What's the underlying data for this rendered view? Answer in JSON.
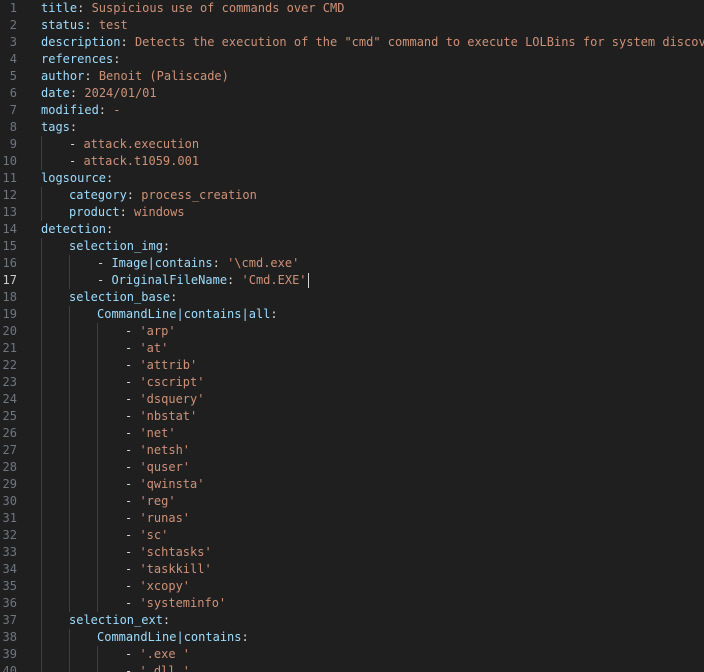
{
  "editor": {
    "current_line": 17,
    "lines": [
      {
        "n": "1",
        "indent": 0,
        "key": "title",
        "sep": ":",
        "val": " Suspicious use of commands over CMD",
        "valClass": "str"
      },
      {
        "n": "2",
        "indent": 0,
        "key": "status",
        "sep": ":",
        "val": " test",
        "valClass": "str"
      },
      {
        "n": "3",
        "indent": 0,
        "key": "description",
        "sep": ":",
        "val": " Detects the execution of the \"cmd\" command to execute LOLBins for system discovery",
        "valClass": "str"
      },
      {
        "n": "4",
        "indent": 0,
        "key": "references",
        "sep": ":",
        "val": "",
        "valClass": "str"
      },
      {
        "n": "5",
        "indent": 0,
        "key": "author",
        "sep": ":",
        "val": " Benoit (Paliscade)",
        "valClass": "str"
      },
      {
        "n": "6",
        "indent": 0,
        "key": "date",
        "sep": ":",
        "val": " 2024/01/01",
        "valClass": "str"
      },
      {
        "n": "7",
        "indent": 0,
        "key": "modified",
        "sep": ":",
        "val": " -",
        "valClass": "str"
      },
      {
        "n": "8",
        "indent": 0,
        "key": "tags",
        "sep": ":",
        "val": "",
        "valClass": "str"
      },
      {
        "n": "9",
        "indent": 1,
        "dash": "- ",
        "key": "",
        "sep": "",
        "val": "attack.execution",
        "valClass": "str"
      },
      {
        "n": "10",
        "indent": 1,
        "dash": "- ",
        "key": "",
        "sep": "",
        "val": "attack.t1059.001",
        "valClass": "str"
      },
      {
        "n": "11",
        "indent": 0,
        "key": "logsource",
        "sep": ":",
        "val": "",
        "valClass": "str"
      },
      {
        "n": "12",
        "indent": 1,
        "key": "category",
        "sep": ":",
        "val": " process_creation",
        "valClass": "str"
      },
      {
        "n": "13",
        "indent": 1,
        "key": "product",
        "sep": ":",
        "val": " windows",
        "valClass": "str"
      },
      {
        "n": "14",
        "indent": 0,
        "key": "detection",
        "sep": ":",
        "val": "",
        "valClass": "str"
      },
      {
        "n": "15",
        "indent": 1,
        "key": "selection_img",
        "sep": ":",
        "val": "",
        "valClass": "str"
      },
      {
        "n": "16",
        "indent": 2,
        "dash": "- ",
        "key": "Image|contains",
        "sep": ":",
        "val": " '\\cmd.exe'",
        "valClass": "str"
      },
      {
        "n": "17",
        "indent": 2,
        "dash": "- ",
        "key": "OriginalFileName",
        "sep": ":",
        "val": " 'Cmd.EXE'",
        "valClass": "str",
        "cursor": true
      },
      {
        "n": "18",
        "indent": 1,
        "key": "selection_base",
        "sep": ":",
        "val": "",
        "valClass": "str"
      },
      {
        "n": "19",
        "indent": 2,
        "key": "CommandLine|contains|all",
        "sep": ":",
        "val": "",
        "valClass": "str"
      },
      {
        "n": "20",
        "indent": 3,
        "dash": "- ",
        "key": "",
        "sep": "",
        "val": "'arp'",
        "valClass": "str"
      },
      {
        "n": "21",
        "indent": 3,
        "dash": "- ",
        "key": "",
        "sep": "",
        "val": "'at'",
        "valClass": "str"
      },
      {
        "n": "22",
        "indent": 3,
        "dash": "- ",
        "key": "",
        "sep": "",
        "val": "'attrib'",
        "valClass": "str"
      },
      {
        "n": "23",
        "indent": 3,
        "dash": "- ",
        "key": "",
        "sep": "",
        "val": "'cscript'",
        "valClass": "str"
      },
      {
        "n": "24",
        "indent": 3,
        "dash": "- ",
        "key": "",
        "sep": "",
        "val": "'dsquery'",
        "valClass": "str"
      },
      {
        "n": "25",
        "indent": 3,
        "dash": "- ",
        "key": "",
        "sep": "",
        "val": "'nbstat'",
        "valClass": "str"
      },
      {
        "n": "26",
        "indent": 3,
        "dash": "- ",
        "key": "",
        "sep": "",
        "val": "'net'",
        "valClass": "str"
      },
      {
        "n": "27",
        "indent": 3,
        "dash": "- ",
        "key": "",
        "sep": "",
        "val": "'netsh'",
        "valClass": "str"
      },
      {
        "n": "28",
        "indent": 3,
        "dash": "- ",
        "key": "",
        "sep": "",
        "val": "'quser'",
        "valClass": "str"
      },
      {
        "n": "29",
        "indent": 3,
        "dash": "- ",
        "key": "",
        "sep": "",
        "val": "'qwinsta'",
        "valClass": "str"
      },
      {
        "n": "30",
        "indent": 3,
        "dash": "- ",
        "key": "",
        "sep": "",
        "val": "'reg'",
        "valClass": "str"
      },
      {
        "n": "31",
        "indent": 3,
        "dash": "- ",
        "key": "",
        "sep": "",
        "val": "'runas'",
        "valClass": "str"
      },
      {
        "n": "32",
        "indent": 3,
        "dash": "- ",
        "key": "",
        "sep": "",
        "val": "'sc'",
        "valClass": "str"
      },
      {
        "n": "33",
        "indent": 3,
        "dash": "- ",
        "key": "",
        "sep": "",
        "val": "'schtasks'",
        "valClass": "str"
      },
      {
        "n": "34",
        "indent": 3,
        "dash": "- ",
        "key": "",
        "sep": "",
        "val": "'taskkill'",
        "valClass": "str"
      },
      {
        "n": "35",
        "indent": 3,
        "dash": "- ",
        "key": "",
        "sep": "",
        "val": "'xcopy'",
        "valClass": "str"
      },
      {
        "n": "36",
        "indent": 3,
        "dash": "- ",
        "key": "",
        "sep": "",
        "val": "'systeminfo'",
        "valClass": "str"
      },
      {
        "n": "37",
        "indent": 1,
        "key": "selection_ext",
        "sep": ":",
        "val": "",
        "valClass": "str"
      },
      {
        "n": "38",
        "indent": 2,
        "key": "CommandLine|contains",
        "sep": ":",
        "val": "",
        "valClass": "str"
      },
      {
        "n": "39",
        "indent": 3,
        "dash": "- ",
        "key": "",
        "sep": "",
        "val": "'.exe '",
        "valClass": "str"
      },
      {
        "n": "40",
        "indent": 3,
        "dash": "- ",
        "key": "",
        "sep": "",
        "val": "'.dll '",
        "valClass": "str"
      }
    ]
  },
  "colors": {
    "background": "#1f1f1f",
    "key": "#9cdcfe",
    "string": "#ce9178",
    "line_number": "#6e7681",
    "line_number_current": "#cccccc"
  }
}
